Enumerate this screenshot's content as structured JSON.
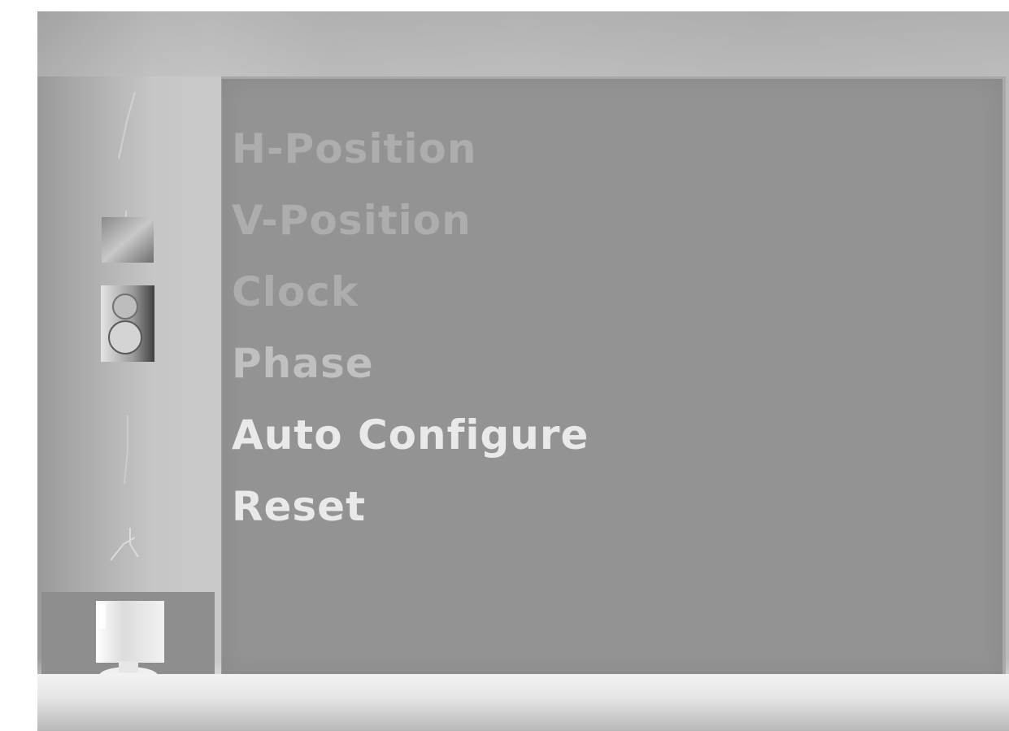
{
  "sidebar": {
    "items": [
      {
        "icon": "line-icon",
        "selected": false
      },
      {
        "icon": "picture-icon",
        "selected": false
      },
      {
        "icon": "speaker-icon",
        "selected": false
      },
      {
        "icon": "line-icon",
        "selected": false
      },
      {
        "icon": "spark-icon",
        "selected": false
      },
      {
        "icon": "monitor-icon",
        "selected": true
      }
    ]
  },
  "menu": {
    "items": [
      {
        "label": "H-Position"
      },
      {
        "label": "V-Position"
      },
      {
        "label": "Clock"
      },
      {
        "label": "Phase"
      },
      {
        "label": "Auto Configure"
      },
      {
        "label": "Reset"
      }
    ]
  },
  "colors": {
    "panel": "#939393",
    "selected_sidebar": "#8e8e8e",
    "text_bright": "#e9e9e9",
    "text_normal": "#c0c0c0"
  }
}
